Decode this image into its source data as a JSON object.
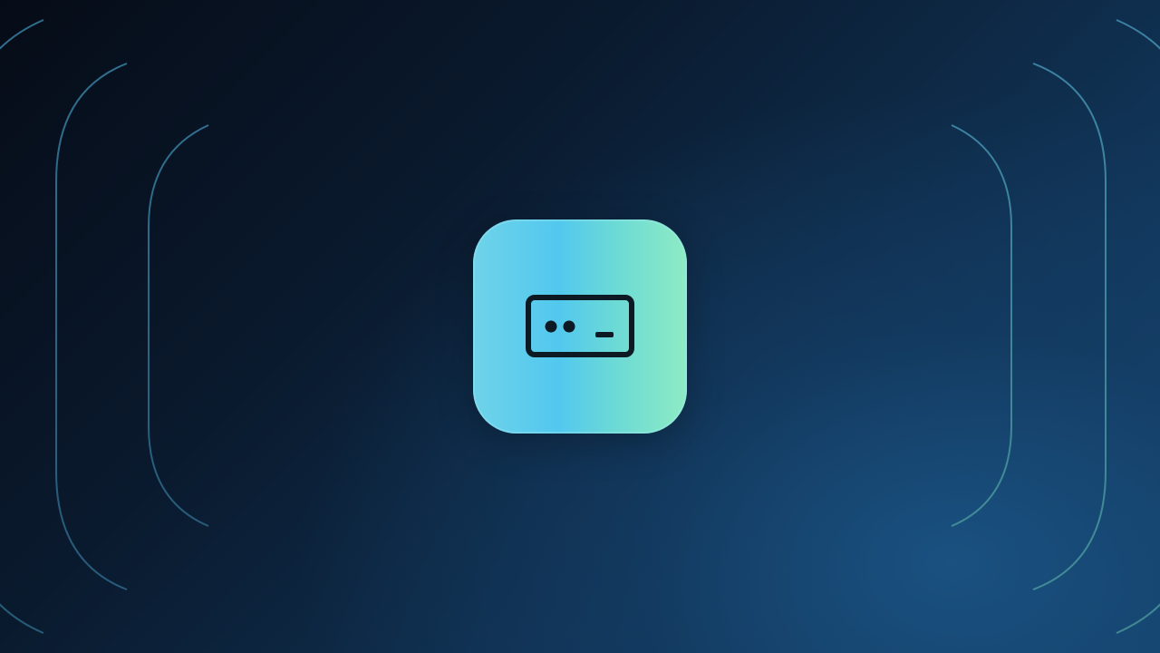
{
  "app_icon": {
    "icon": "password-field-icon",
    "gradient_start": "#52c8ee",
    "gradient_end": "#8eebc4",
    "glyph_color": "#0d1a24"
  },
  "background": {
    "dark": "#060c17",
    "light": "#174a78",
    "arc_color": "#4fa6c6"
  }
}
